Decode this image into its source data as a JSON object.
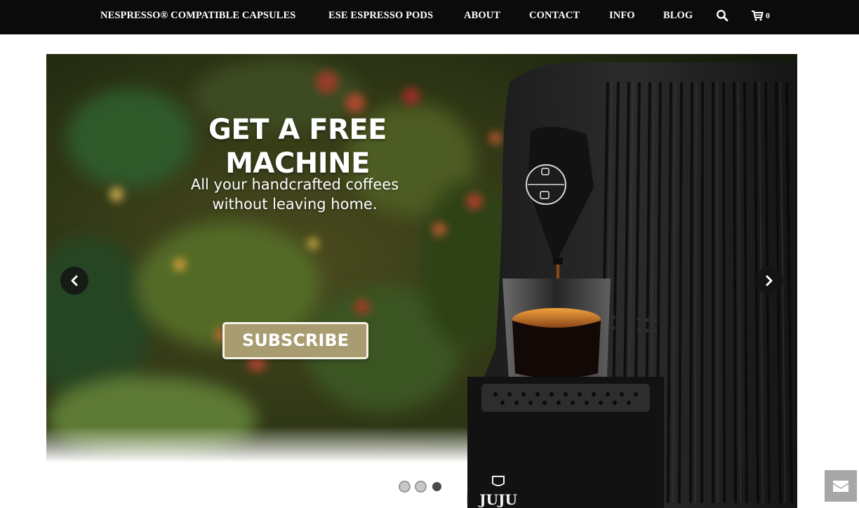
{
  "nav": {
    "items": [
      {
        "label": "NESPRESSO® COMPATIBLE CAPSULES"
      },
      {
        "label": "ESE ESPRESSO PODS"
      },
      {
        "label": "ABOUT"
      },
      {
        "label": "CONTACT"
      },
      {
        "label": "INFO"
      },
      {
        "label": "BLOG"
      }
    ],
    "cart_count": "0",
    "search_icon": "search-icon",
    "cart_icon": "cart-icon"
  },
  "hero": {
    "title": "GET A FREE MACHINE",
    "subtitle_line1": "All your handcrafted coffees",
    "subtitle_line2": "without leaving home.",
    "button_label": "SUBSCRIBE",
    "machine_brand": "JUJU",
    "prev_icon": "chevron-left-icon",
    "next_icon": "chevron-right-icon",
    "slides_total": 3,
    "active_slide": 3,
    "accent_color": "#a99c70"
  },
  "contact_fab": {
    "icon": "envelope-icon"
  }
}
